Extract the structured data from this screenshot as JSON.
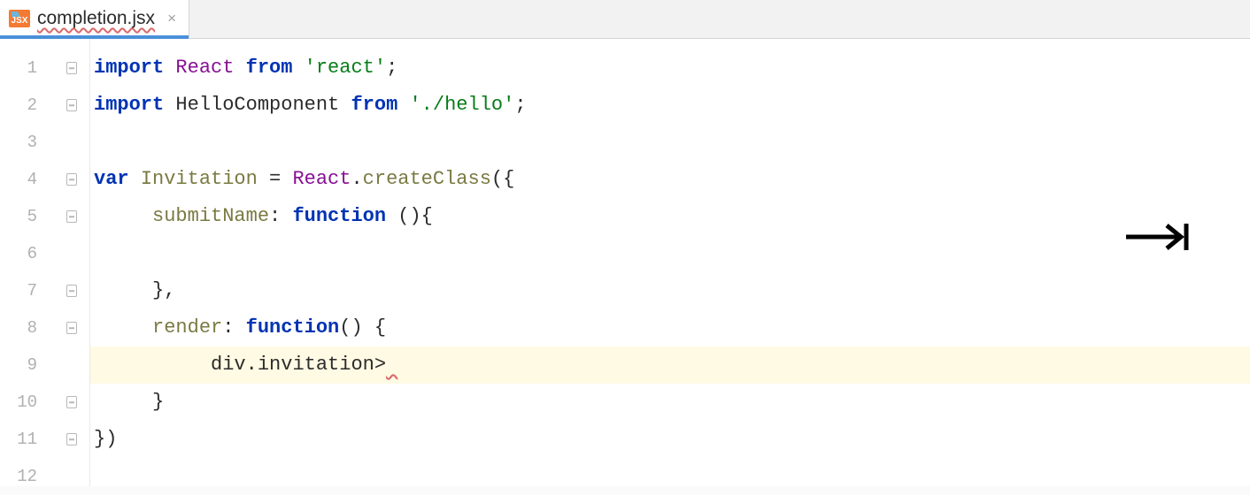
{
  "tab": {
    "label": "completion.jsx",
    "icon_text": "JSX"
  },
  "gutter": {
    "lines": [
      "1",
      "2",
      "3",
      "4",
      "5",
      "6",
      "7",
      "8",
      "9",
      "10",
      "11",
      "12"
    ]
  },
  "code": {
    "line1": {
      "import": "import",
      "react": "React",
      "from": "from",
      "str": "'react'",
      "semi": ";"
    },
    "line2": {
      "import": "import",
      "comp": "HelloComponent",
      "from": "from",
      "str": "'./hello'",
      "semi": ";"
    },
    "line4": {
      "varkw": "var",
      "name": "Invitation",
      "eq": " = ",
      "react": "React",
      "dot": ".",
      "method": "createClass",
      "open": "({"
    },
    "line5": {
      "prop": "submitName",
      "colon": ": ",
      "func": "function",
      "paren": " (){"
    },
    "line7": {
      "close": "},"
    },
    "line8": {
      "prop": "render",
      "colon": ": ",
      "func": "function",
      "paren": "() {"
    },
    "line9": {
      "text": "div.invitation>",
      "err": " "
    },
    "line10": {
      "close": "}"
    },
    "line11": {
      "close": "})"
    }
  }
}
